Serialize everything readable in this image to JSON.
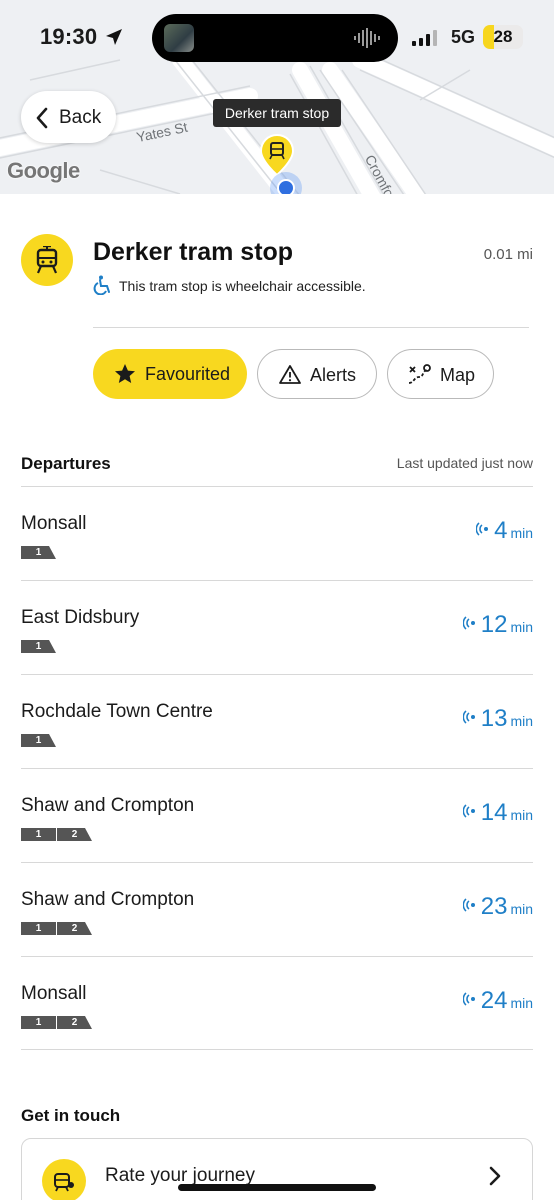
{
  "status_bar": {
    "time": "19:30",
    "network": "5G",
    "battery": "28",
    "battery_fraction": 0.28
  },
  "map": {
    "back_label": "Back",
    "streets": [
      "Yates St",
      "Cromford S"
    ],
    "google_logo": "Google",
    "tooltip": "Derker tram stop"
  },
  "stop": {
    "title": "Derker tram stop",
    "distance": "0.01 mi",
    "accessibility": "This tram stop is wheelchair accessible."
  },
  "actions": {
    "favourited": "Favourited",
    "alerts": "Alerts",
    "map": "Map"
  },
  "departures": {
    "heading": "Departures",
    "updated": "Last updated just now",
    "rows": [
      {
        "destination": "Monsall",
        "tags": [
          "1"
        ],
        "minutes": "4",
        "unit": "min"
      },
      {
        "destination": "East Didsbury",
        "tags": [
          "1"
        ],
        "minutes": "12",
        "unit": "min"
      },
      {
        "destination": "Rochdale Town Centre",
        "tags": [
          "1"
        ],
        "minutes": "13",
        "unit": "min"
      },
      {
        "destination": "Shaw and Crompton",
        "tags": [
          "1",
          "2"
        ],
        "minutes": "14",
        "unit": "min"
      },
      {
        "destination": "Shaw and Crompton",
        "tags": [
          "1",
          "2"
        ],
        "minutes": "23",
        "unit": "min"
      },
      {
        "destination": "Monsall",
        "tags": [
          "1",
          "2"
        ],
        "minutes": "24",
        "unit": "min"
      }
    ]
  },
  "get_in_touch": {
    "heading": "Get in touch",
    "rate_label": "Rate your journey"
  },
  "colors": {
    "accent_yellow": "#f8d81f",
    "live_blue": "#1f7fc7",
    "tag_grey": "#555555"
  }
}
